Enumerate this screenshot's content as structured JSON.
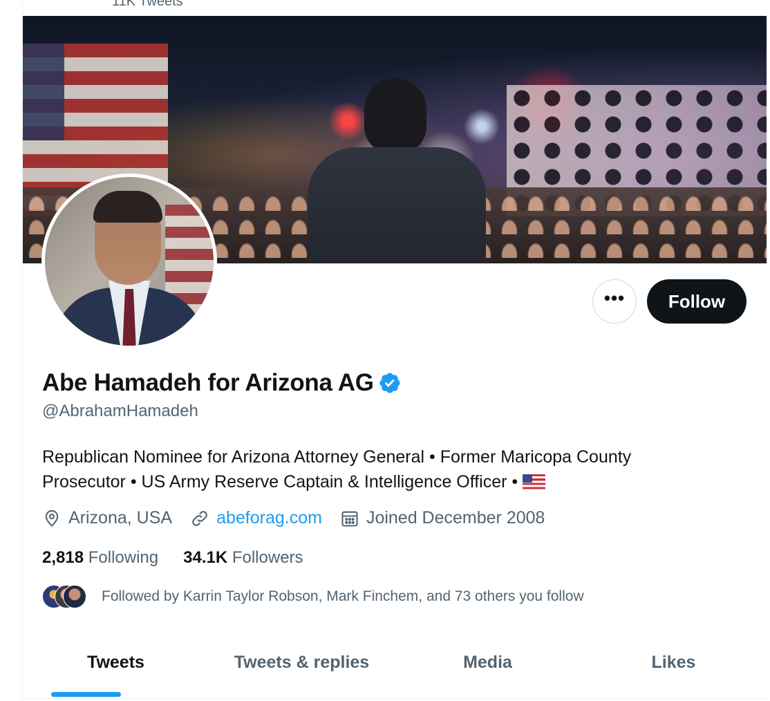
{
  "header": {
    "tweet_count": "11K Tweets"
  },
  "profile": {
    "display_name": "Abe Hamadeh for Arizona AG",
    "handle": "@AbrahamHamadeh",
    "verified": true,
    "bio_line1": "Republican Nominee for Arizona Attorney General • Former Maricopa County",
    "bio_line2": "Prosecutor • US Army Reserve Captain & Intelligence Officer •",
    "bio_flag": "us-flag-emoji",
    "location": "Arizona, USA",
    "website": "abeforag.com",
    "joined": "Joined December 2008"
  },
  "actions": {
    "more_label": "•••",
    "follow_label": "Follow"
  },
  "stats": {
    "following_count": "2,818",
    "following_label": "Following",
    "followers_count": "34.1K",
    "followers_label": "Followers"
  },
  "followed_by": "Followed by Karrin Taylor Robson, Mark Finchem, and 73 others you follow",
  "tabs": [
    {
      "label": "Tweets",
      "active": true
    },
    {
      "label": "Tweets & replies",
      "active": false
    },
    {
      "label": "Media",
      "active": false
    },
    {
      "label": "Likes",
      "active": false
    }
  ],
  "colors": {
    "accent": "#1d9bf0",
    "text": "#0f1419",
    "secondary": "#536471",
    "button_dark": "#0f1419"
  },
  "icons": [
    "location-pin-icon",
    "link-icon",
    "calendar-icon",
    "verified-badge-icon",
    "more-icon"
  ]
}
